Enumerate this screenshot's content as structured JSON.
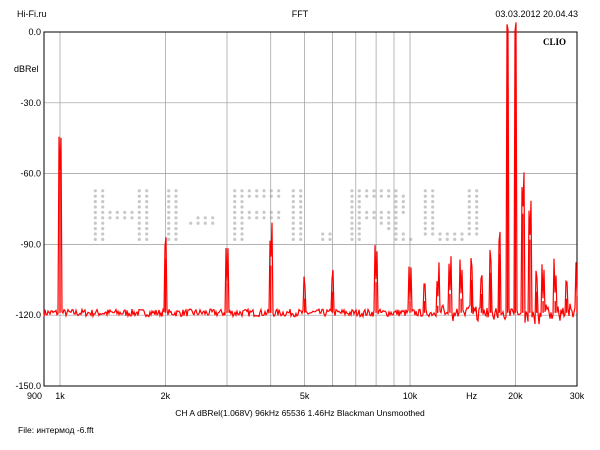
{
  "header": {
    "left": "Hi-Fi.ru",
    "center": "FFT",
    "right": "03.03.2012 20.04.43"
  },
  "brand_label": "CLIO",
  "watermark_text": "HI-FI.RU",
  "channel_info": "CH A   dBRel(1.068V)   96kHz   65536   1.46Hz   Blackman   Unsmoothed",
  "file_info": "File: интермод -6.fft",
  "colors": {
    "trace": "#ff0000",
    "grid": "#9a9a9a",
    "frame": "#000000",
    "watermark": "#c8c8c8",
    "background": "#ffffff"
  },
  "chart_data": {
    "type": "line",
    "title": "FFT",
    "xlabel": "Hz",
    "ylabel": "dBRel",
    "x_scale": "log",
    "xlim": [
      900,
      30000
    ],
    "ylim": [
      -150,
      0
    ],
    "grid": true,
    "y_ticks": [
      {
        "value": 0,
        "label": "0.0"
      },
      {
        "value": -30,
        "label": "-30.0"
      },
      {
        "value": -60,
        "label": "-60.0"
      },
      {
        "value": -90,
        "label": "-90.0"
      },
      {
        "value": -120,
        "label": "-120.0"
      },
      {
        "value": -150,
        "label": "-150.0"
      }
    ],
    "x_ticks": [
      {
        "value": 900,
        "label": "900"
      },
      {
        "value": 1000,
        "label": "1k"
      },
      {
        "value": 2000,
        "label": "2k"
      },
      {
        "value": 5000,
        "label": "5k"
      },
      {
        "value": 10000,
        "label": "10k"
      },
      {
        "value": 15000,
        "label": "Hz"
      },
      {
        "value": 20000,
        "label": "20k"
      },
      {
        "value": 30000,
        "label": "30k"
      }
    ],
    "x_gridlines": [
      1000,
      2000,
      3000,
      4000,
      5000,
      6000,
      7000,
      8000,
      9000,
      10000,
      20000
    ],
    "noise_floor_db": -119,
    "series": [
      {
        "peaks": [
          {
            "x": 1000,
            "y": -59
          },
          {
            "x": 2000,
            "y": -96
          },
          {
            "x": 3000,
            "y": -106
          },
          {
            "x": 4000,
            "y": -99
          },
          {
            "x": 5000,
            "y": -113
          },
          {
            "x": 6000,
            "y": -110
          },
          {
            "x": 8000,
            "y": -106
          },
          {
            "x": 10000,
            "y": -114
          },
          {
            "x": 11000,
            "y": -114
          },
          {
            "x": 12000,
            "y": -116
          },
          {
            "x": 13000,
            "y": -111
          },
          {
            "x": 14000,
            "y": -113
          },
          {
            "x": 15000,
            "y": -105
          },
          {
            "x": 16000,
            "y": -111
          },
          {
            "x": 17000,
            "y": -102
          },
          {
            "x": 18000,
            "y": -94
          },
          {
            "x": 19000,
            "y": -5
          },
          {
            "x": 20000,
            "y": -5
          },
          {
            "x": 21000,
            "y": -77
          },
          {
            "x": 22000,
            "y": -88
          },
          {
            "x": 23000,
            "y": -110
          },
          {
            "x": 24000,
            "y": -114
          },
          {
            "x": 26000,
            "y": -114
          },
          {
            "x": 28000,
            "y": -113
          },
          {
            "x": 30000,
            "y": -112
          }
        ]
      }
    ]
  }
}
